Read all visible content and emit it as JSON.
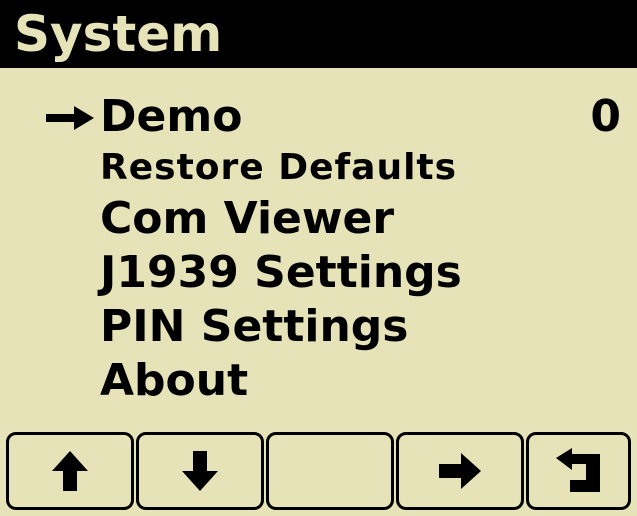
{
  "title": "System",
  "menu": {
    "items": [
      {
        "label": "Demo",
        "value": "0",
        "selected": true
      },
      {
        "label": "Restore Defaults"
      },
      {
        "label": "Com Viewer"
      },
      {
        "label": "J1939 Settings"
      },
      {
        "label": "PIN Settings"
      },
      {
        "label": "About"
      }
    ]
  },
  "softkeys": [
    {
      "icon": "arrow-up-icon"
    },
    {
      "icon": "arrow-down-icon"
    },
    {
      "icon": ""
    },
    {
      "icon": "arrow-right-icon"
    },
    {
      "icon": "back-return-icon"
    }
  ],
  "colors": {
    "background": "#e6e3b8",
    "foreground": "#000000"
  }
}
